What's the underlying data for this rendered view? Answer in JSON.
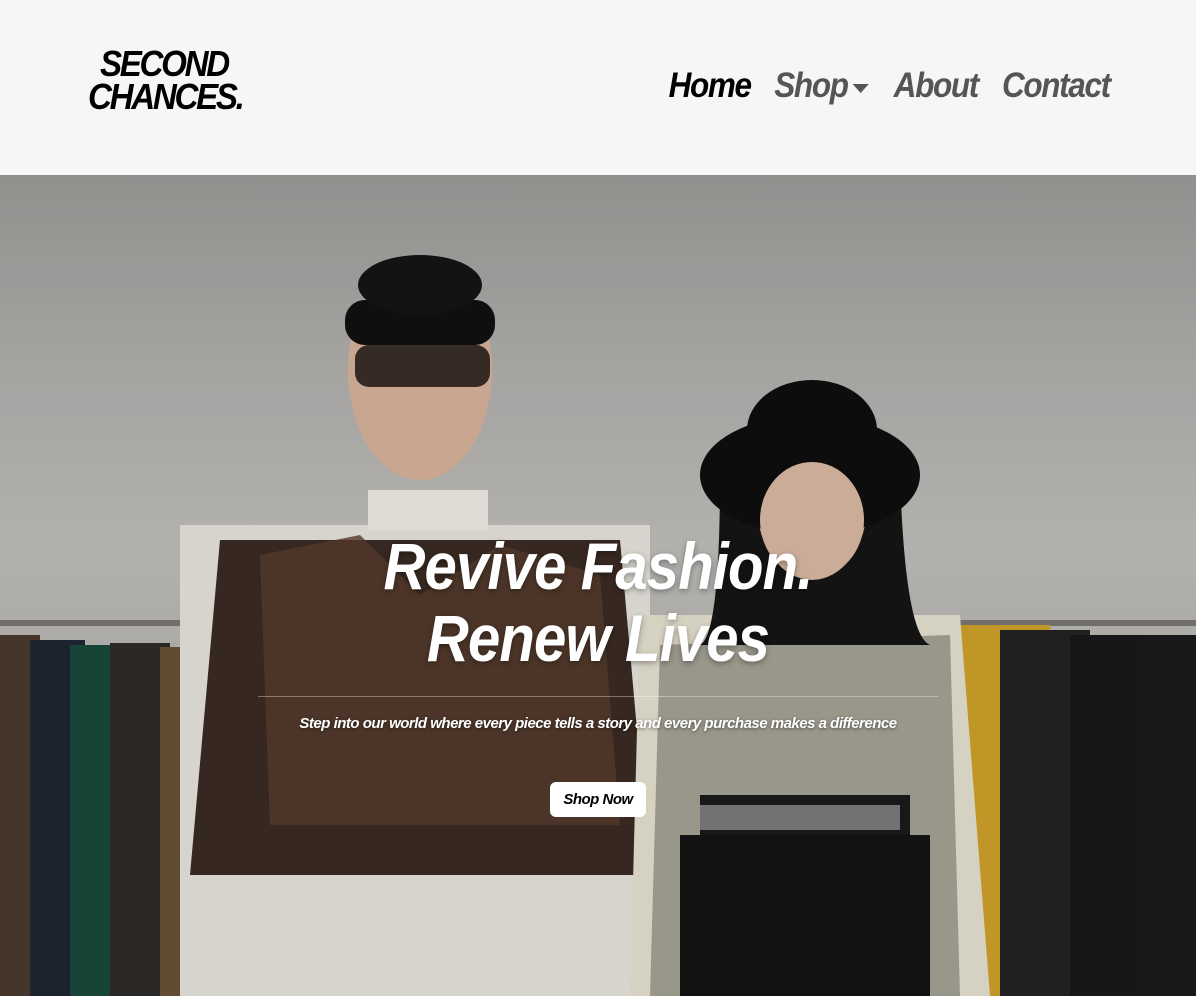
{
  "brand": {
    "line1": "SECOND",
    "line2": "CHANCES."
  },
  "nav": {
    "home": "Home",
    "shop": "Shop",
    "about": "About",
    "contact": "Contact"
  },
  "hero": {
    "title": "Revive Fashion. Renew Lives",
    "subtitle": "Step into our world where every piece tells a story and every purchase makes a difference",
    "cta": "Shop Now"
  },
  "colors": {
    "accent": "#000000",
    "muted": "#555555",
    "background": "#f6f6f6"
  }
}
